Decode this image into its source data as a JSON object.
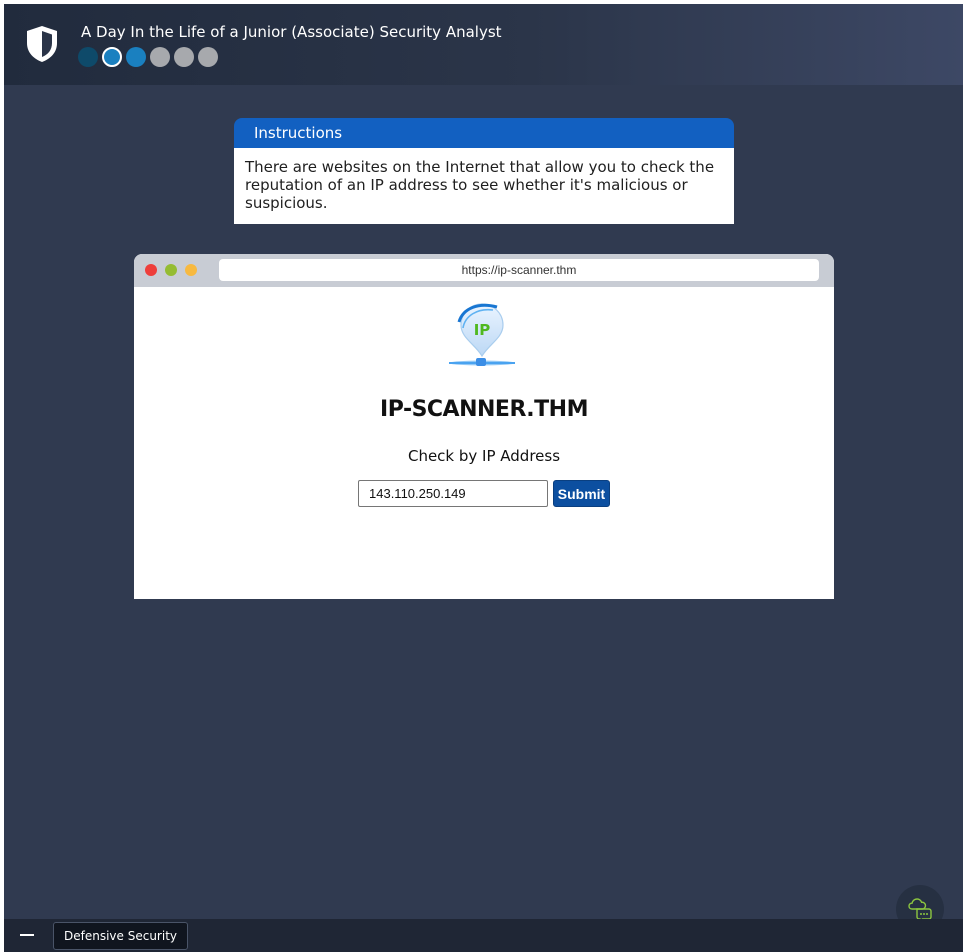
{
  "header": {
    "title": "A Day In the Life of a Junior (Associate) Security Analyst",
    "progress": [
      "done",
      "current",
      "next",
      "todo",
      "todo",
      "todo"
    ]
  },
  "instructions": {
    "heading": "Instructions",
    "body": "There are websites on the Internet that allow you to check the reputation of an IP address to see whether it's malicious or suspicious."
  },
  "browser": {
    "url": "https://ip-scanner.thm",
    "logo_text": "IP",
    "site_title": "IP-SCANNER.THM",
    "check_label": "Check by IP Address",
    "ip_value": "143.110.250.149",
    "submit_label": "Submit"
  },
  "footer": {
    "category": "Defensive Security"
  },
  "icons": {
    "app": "shield-icon",
    "chat": "chat-bubbles-icon",
    "minimize": "minimize-icon"
  },
  "colors": {
    "background": "#303a50",
    "instructions_header": "#1260c1",
    "submit": "#0c4fa0",
    "progress_active": "#1a80c0",
    "progress_done": "#0e4a6a",
    "progress_todo": "#a7a9ad"
  }
}
